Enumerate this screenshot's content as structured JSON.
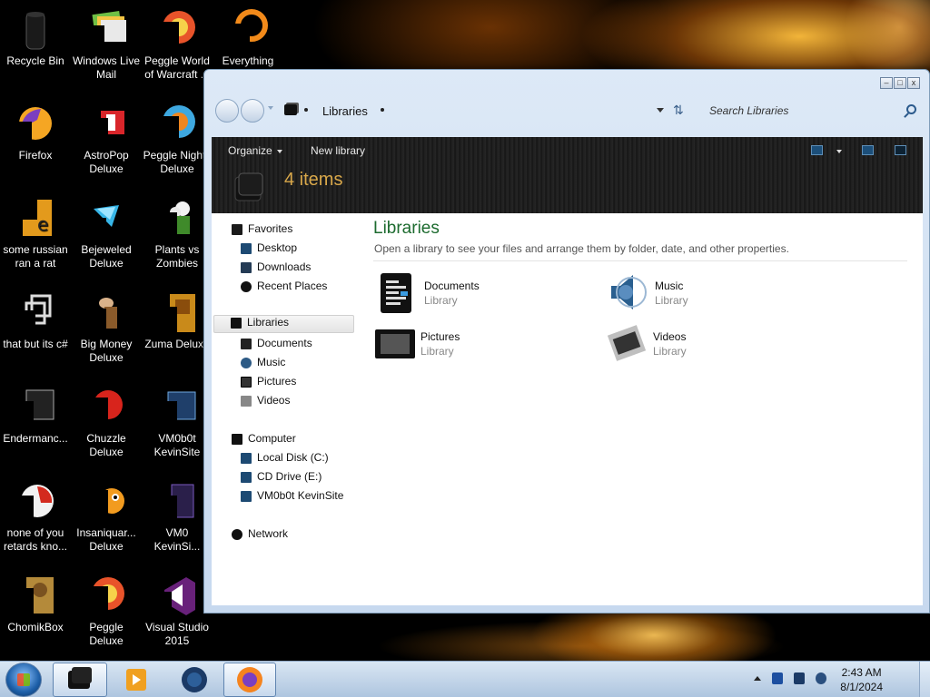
{
  "desktop_icons": [
    {
      "name": "recycle-bin-icon",
      "label": "Recycle Bin"
    },
    {
      "name": "windows-live-mail-icon",
      "label": "Windows Live Mail"
    },
    {
      "name": "peggle-world-of-warcraft-icon",
      "label": "Peggle World of Warcraft ..."
    },
    {
      "name": "everything-icon",
      "label": "Everything"
    },
    {
      "name": "firefox-icon",
      "label": "Firefox"
    },
    {
      "name": "astropop-deluxe-icon",
      "label": "AstroPop Deluxe"
    },
    {
      "name": "peggle-nights-deluxe-icon",
      "label": "Peggle Nights Deluxe"
    },
    {
      "name": "some-russian-ran-a-rat-icon",
      "label": "some russian ran a rat"
    },
    {
      "name": "bejeweled-deluxe-icon",
      "label": "Bejeweled Deluxe"
    },
    {
      "name": "plants-vs-zombies-icon",
      "label": "Plants vs Zombies"
    },
    {
      "name": "that-but-its-csharp-icon",
      "label": "that but its c#"
    },
    {
      "name": "big-money-deluxe-icon",
      "label": "Big Money Deluxe"
    },
    {
      "name": "zuma-deluxe-icon",
      "label": "Zuma Deluxe"
    },
    {
      "name": "endermanc-icon",
      "label": "Endermanc..."
    },
    {
      "name": "chuzzle-deluxe-icon",
      "label": "Chuzzle Deluxe"
    },
    {
      "name": "vm0b0t-kevinsite-icon",
      "label": "VM0b0t KevinSite"
    },
    {
      "name": "none-of-you-icon",
      "label": "none of you retards kno..."
    },
    {
      "name": "insaniquarium-deluxe-icon",
      "label": "Insaniquar... Deluxe"
    },
    {
      "name": "vm0-kevinsi-icon",
      "label": "VM0 KevinSi..."
    },
    {
      "name": "chomikbox-icon",
      "label": "ChomikBox"
    },
    {
      "name": "peggle-deluxe-icon",
      "label": "Peggle Deluxe"
    },
    {
      "name": "visual-studio-2015-icon",
      "label": "Visual Studio 2015"
    }
  ],
  "window": {
    "controls": {
      "minimize": "–",
      "maximize": "□",
      "close": "x"
    },
    "address": "Libraries",
    "search_placeholder": "Search Libraries",
    "toolbar": {
      "organize_label": "Organize",
      "new_library_label": "New library",
      "item_count": "4 items"
    },
    "nav": {
      "favorites": "Favorites",
      "desktop": "Desktop",
      "downloads": "Downloads",
      "recent_places": "Recent Places",
      "libraries": "Libraries",
      "documents": "Documents",
      "music": "Music",
      "pictures": "Pictures",
      "videos": "Videos",
      "computer": "Computer",
      "local_disk": "Local Disk (C:)",
      "cd_drive": "CD Drive (E:)",
      "vm0b0t": "VM0b0t KevinSite",
      "network": "Network"
    },
    "main": {
      "title": "Libraries",
      "description": "Open a library to see your files and arrange them by folder, date, and other properties.",
      "libraries": [
        {
          "name": "Documents",
          "type": "Library",
          "icon": "documents-icon"
        },
        {
          "name": "Music",
          "type": "Library",
          "icon": "music-icon"
        },
        {
          "name": "Pictures",
          "type": "Library",
          "icon": "pictures-icon"
        },
        {
          "name": "Videos",
          "type": "Library",
          "icon": "videos-icon"
        }
      ]
    }
  },
  "taskbar": {
    "time": "2:43 AM",
    "date": "8/1/2024"
  }
}
